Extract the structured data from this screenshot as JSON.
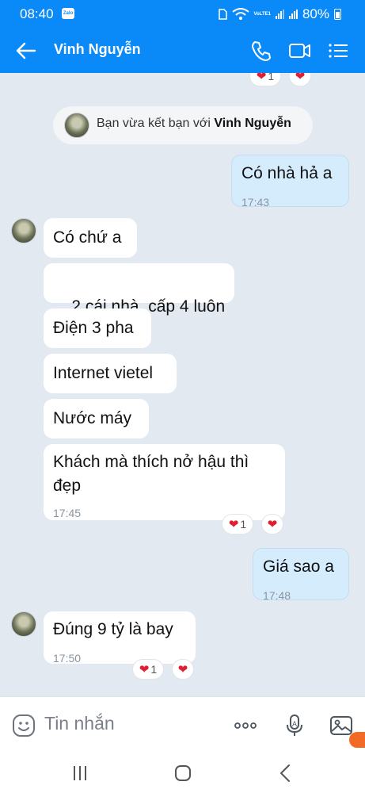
{
  "status_bar": {
    "time": "08:40",
    "app_badge": "Zalo",
    "network": "VoLTE1",
    "battery": "80%"
  },
  "header": {
    "contact_name": "Vinh Nguyễn"
  },
  "system_message": {
    "prefix": "Bạn vừa kết bạn với ",
    "name": "Vinh Nguyễn"
  },
  "messages": [
    {
      "direction": "out",
      "text": "Có nhà hả a",
      "time": "17:43"
    },
    {
      "direction": "in",
      "text": "Có chứ a"
    },
    {
      "direction": "in",
      "text": "2 cái nhà  cấp 4 luôn"
    },
    {
      "direction": "in",
      "text": "Điện 3 pha"
    },
    {
      "direction": "in",
      "text": "Internet vietel"
    },
    {
      "direction": "in",
      "text": "Nước máy"
    },
    {
      "direction": "in",
      "text_line1": "Khách mà thích nở hậu thì",
      "text_line2": "đẹp",
      "time": "17:45",
      "reaction_count": "1"
    },
    {
      "direction": "out",
      "text": "Giá sao a",
      "time": "17:48"
    },
    {
      "direction": "in",
      "text": "Đúng 9 tỷ là bay",
      "time": "17:50",
      "reaction_count": "1"
    }
  ],
  "top_reaction": {
    "count": "1"
  },
  "composer": {
    "placeholder": "Tin nhắn"
  },
  "colors": {
    "accent": "#0a8af8",
    "chat_bg": "#e2e9f1",
    "outgoing_bubble": "#d5ecfd",
    "heart": "#e02030"
  },
  "icons": [
    "back-icon",
    "phone-icon",
    "video-call-icon",
    "menu-icon",
    "sticker-icon",
    "more-icon",
    "mic-icon",
    "image-icon",
    "nav-recents-icon",
    "nav-home-icon",
    "nav-back-icon"
  ]
}
